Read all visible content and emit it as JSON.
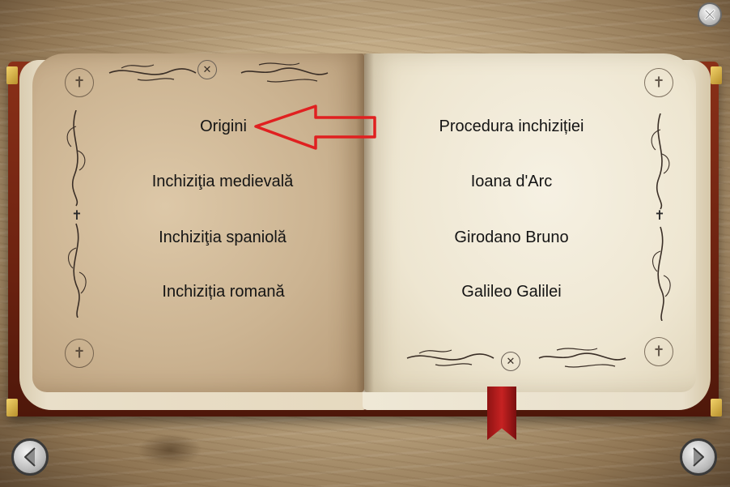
{
  "menu": {
    "left": [
      {
        "label": "Origini"
      },
      {
        "label": "Inchiziţia medievală"
      },
      {
        "label": "Inchiziţia spaniolă"
      },
      {
        "label": "Inchiziția romană"
      }
    ],
    "right": [
      {
        "label": "Procedura inchiziției"
      },
      {
        "label": "Ioana d'Arc"
      },
      {
        "label": "Girodano Bruno"
      },
      {
        "label": "Galileo Galilei"
      }
    ]
  },
  "navigation": {
    "prev_icon": "chevron-left-icon",
    "next_icon": "chevron-right-icon",
    "close_icon": "close-icon"
  },
  "annotation": {
    "arrow_color": "#e02020",
    "target": "Origini"
  },
  "colors": {
    "ribbon": "#c62222",
    "cover": "#7a2812"
  }
}
